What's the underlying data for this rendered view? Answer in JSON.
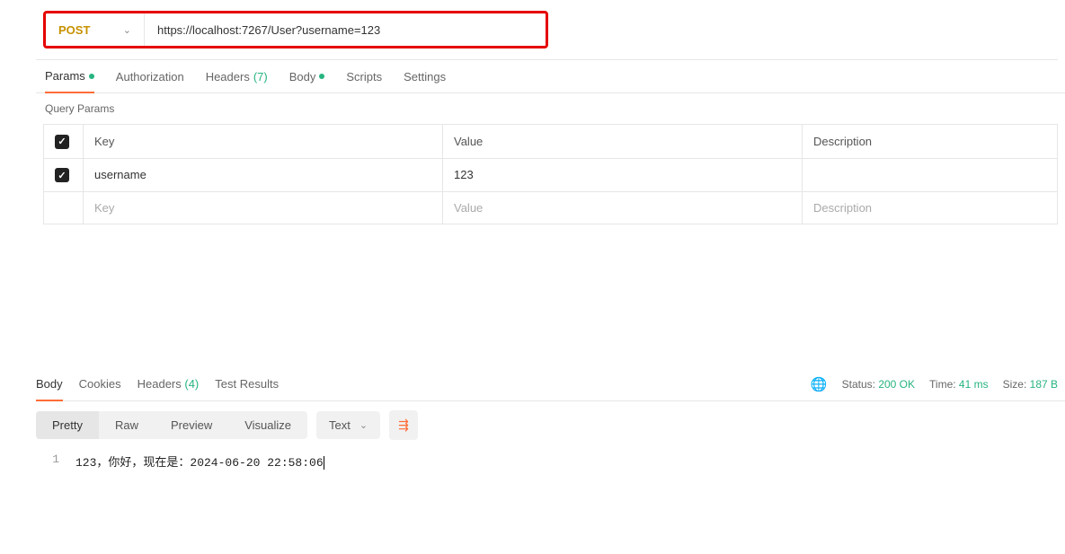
{
  "request": {
    "method": "POST",
    "url": "https://localhost:7267/User?username=123"
  },
  "request_tabs": {
    "params": {
      "label": "Params"
    },
    "authorization": {
      "label": "Authorization"
    },
    "headers": {
      "label": "Headers",
      "count": "(7)"
    },
    "body": {
      "label": "Body"
    },
    "scripts": {
      "label": "Scripts"
    },
    "settings": {
      "label": "Settings"
    }
  },
  "query_params": {
    "section_label": "Query Params",
    "headers": {
      "key": "Key",
      "value": "Value",
      "description": "Description"
    },
    "rows": [
      {
        "checked": true,
        "key": "username",
        "value": "123",
        "description": ""
      }
    ],
    "placeholder_row": {
      "key": "Key",
      "value": "Value",
      "description": "Description"
    }
  },
  "response_tabs": {
    "body": "Body",
    "cookies": "Cookies",
    "headers": {
      "label": "Headers",
      "count": "(4)"
    },
    "test_results": "Test Results"
  },
  "response_status": {
    "status_label": "Status:",
    "status_value": "200 OK",
    "time_label": "Time:",
    "time_value": "41 ms",
    "size_label": "Size:",
    "size_value": "187 B"
  },
  "view_modes": {
    "pretty": "Pretty",
    "raw": "Raw",
    "preview": "Preview",
    "visualize": "Visualize",
    "format": "Text"
  },
  "response_body": {
    "line_number": "1",
    "content": "123，你好，现在是：2024-06-20 22:58:06"
  }
}
